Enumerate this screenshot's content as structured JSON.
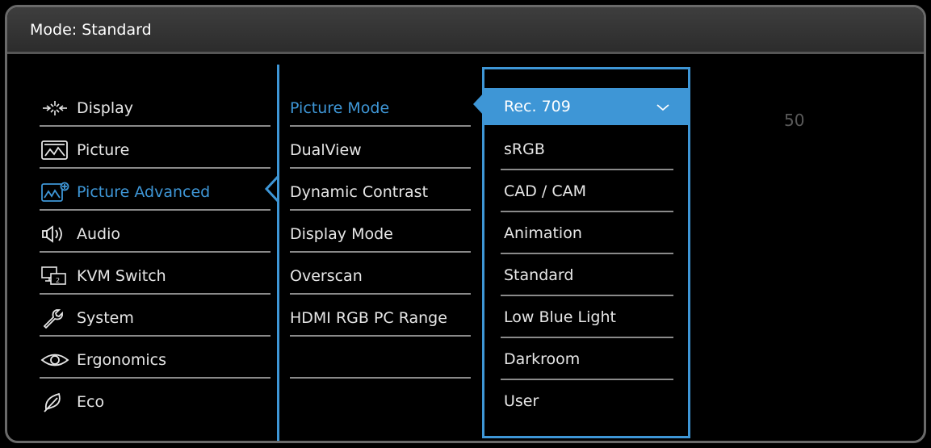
{
  "header": {
    "title": "Mode: Standard"
  },
  "menu": {
    "items": [
      {
        "label": "Display",
        "icon": "display-icon"
      },
      {
        "label": "Picture",
        "icon": "picture-icon"
      },
      {
        "label": "Picture Advanced",
        "icon": "picture-advanced-icon"
      },
      {
        "label": "Audio",
        "icon": "audio-icon"
      },
      {
        "label": "KVM Switch",
        "icon": "kvm-switch-icon"
      },
      {
        "label": "System",
        "icon": "system-icon"
      },
      {
        "label": "Ergonomics",
        "icon": "ergonomics-icon"
      },
      {
        "label": "Eco",
        "icon": "eco-icon"
      }
    ],
    "active_index": 2
  },
  "submenu": {
    "items": [
      "Picture Mode",
      "DualView",
      "Dynamic Contrast",
      "Display Mode",
      "Overscan",
      "HDMI RGB PC Range"
    ],
    "active_index": 0
  },
  "options": {
    "items": [
      "Rec. 709",
      "sRGB",
      "CAD / CAM",
      "Animation",
      "Standard",
      "Low Blue Light",
      "Darkroom",
      "User"
    ],
    "selected_index": 0,
    "checkmark": "✓"
  },
  "value_display": "50",
  "colors": {
    "accent": "#3e96d6",
    "text": "#e6e6e6",
    "separator": "#8a8a8a",
    "dim_value": "#5a5a5a"
  }
}
